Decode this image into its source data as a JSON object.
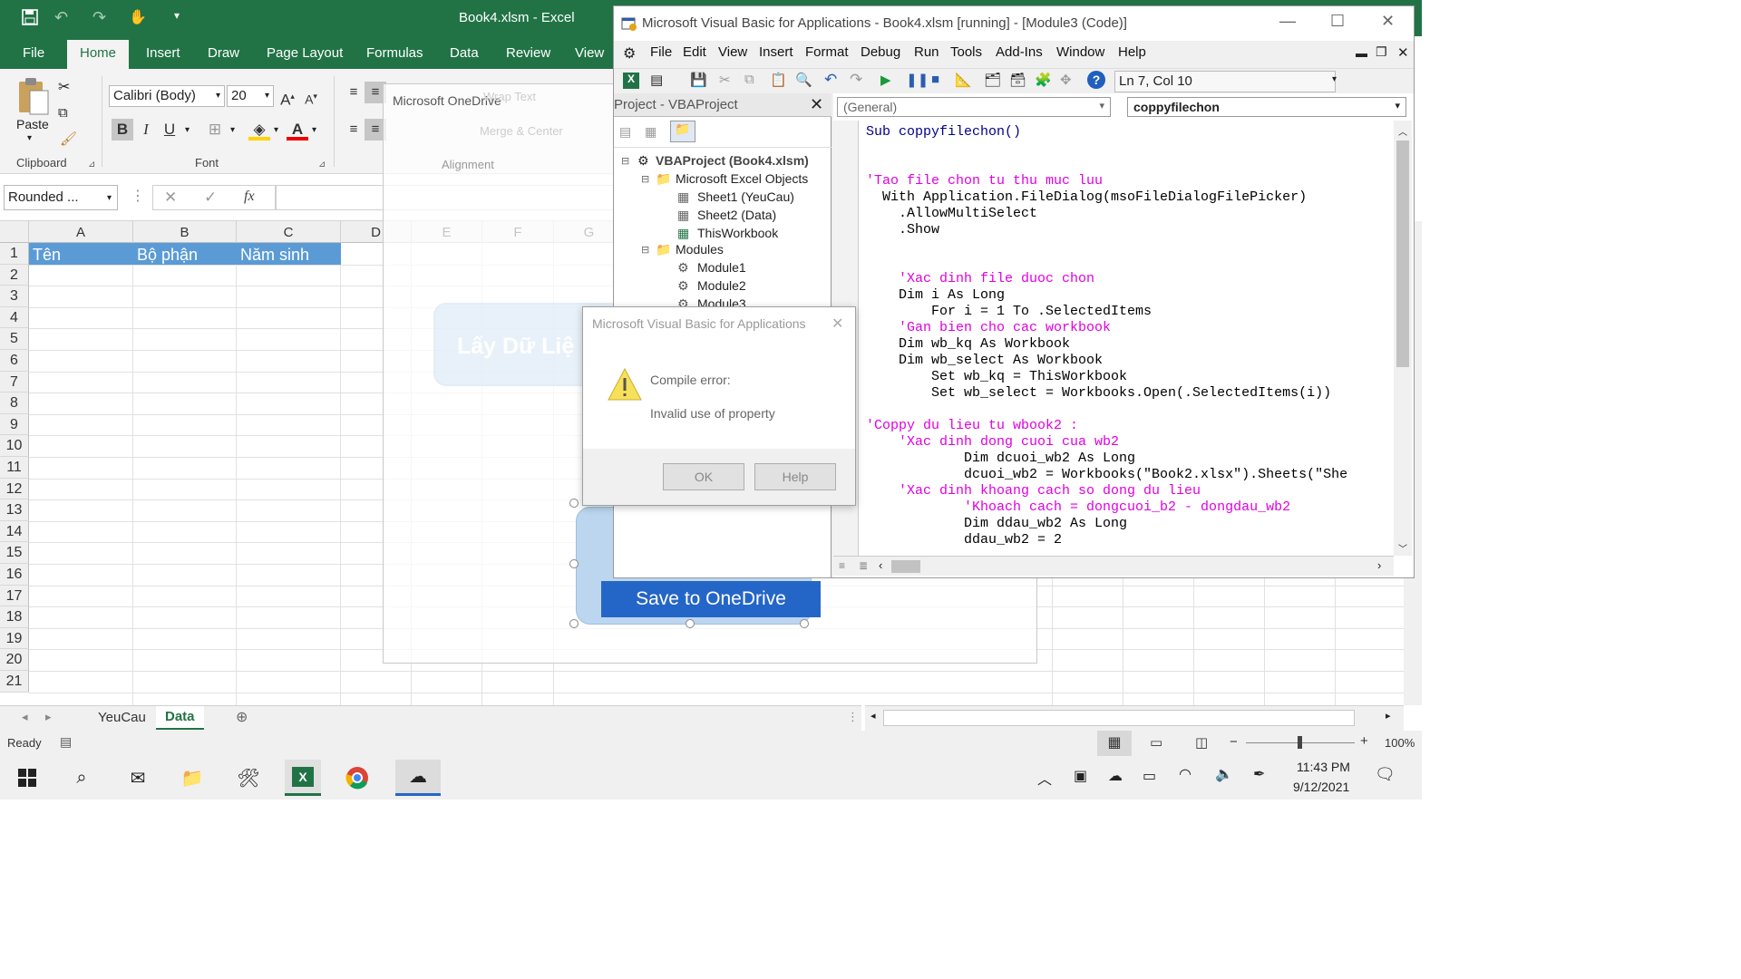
{
  "excel": {
    "title": "Book4.xlsm  -  Excel",
    "tabs": [
      "File",
      "Home",
      "Insert",
      "Draw",
      "Page Layout",
      "Formulas",
      "Data",
      "Review",
      "View"
    ],
    "font_name": "Calibri (Body)",
    "font_size": "20",
    "paste_label": "Paste",
    "groups": {
      "clipboard": "Clipboard",
      "font": "Font",
      "alignment": "Alignment"
    },
    "wrap_text": "Wrap Text",
    "merge_center": "Merge & Center",
    "name_box": "Rounded ...",
    "columns": [
      "A",
      "B",
      "C",
      "D",
      "E",
      "F",
      "G"
    ],
    "rows": [
      "1",
      "2",
      "3",
      "4",
      "5",
      "6",
      "7",
      "8",
      "9",
      "10",
      "11",
      "12",
      "13",
      "14",
      "15",
      "16",
      "17",
      "18",
      "19",
      "20",
      "21"
    ],
    "header_cells": [
      "Tên",
      "Bộ phận",
      "Năm sinh"
    ],
    "button_shape": "Lấy Dữ Liệ",
    "sheets": [
      "YeuCau",
      "Data"
    ],
    "status": "Ready",
    "zoom": "100%",
    "fx_label": "fx"
  },
  "onedrive": {
    "title": "Microsoft OneDrive",
    "button": "Save to OneDrive"
  },
  "vba": {
    "title": "Microsoft Visual Basic for Applications - Book4.xlsm [running] - [Module3 (Code)]",
    "menus": [
      "File",
      "Edit",
      "View",
      "Insert",
      "Format",
      "Debug",
      "Run",
      "Tools",
      "Add-Ins",
      "Window",
      "Help"
    ],
    "position": "Ln 7, Col 10",
    "project_title": "Project - VBAProject",
    "tree": {
      "root": "VBAProject (Book4.xlsm)",
      "objects_folder": "Microsoft Excel Objects",
      "objects": [
        "Sheet1 (YeuCau)",
        "Sheet2 (Data)",
        "ThisWorkbook"
      ],
      "modules_folder": "Modules",
      "modules": [
        "Module1",
        "Module2",
        "Module3"
      ]
    },
    "object_dropdown": "(General)",
    "proc_dropdown": "coppyfilechon",
    "code": [
      {
        "t": "Sub coppyfilechon()",
        "c": "kw"
      },
      {
        "t": "",
        "c": ""
      },
      {
        "t": "",
        "c": ""
      },
      {
        "t": "'Tao file chon tu thu muc luu",
        "c": "cm"
      },
      {
        "t": "  With Application.FileDialog(msoFileDialogFilePicker)",
        "c": ""
      },
      {
        "t": "    .AllowMultiSelect",
        "c": ""
      },
      {
        "t": "    .Show",
        "c": ""
      },
      {
        "t": "",
        "c": ""
      },
      {
        "t": "",
        "c": ""
      },
      {
        "t": "    'Xac dinh file duoc chon",
        "c": "cm"
      },
      {
        "t": "    Dim i As Long",
        "c": ""
      },
      {
        "t": "        For i = 1 To .SelectedItems",
        "c": ""
      },
      {
        "t": "    'Gan bien cho cac workbook",
        "c": "cm"
      },
      {
        "t": "    Dim wb_kq As Workbook",
        "c": ""
      },
      {
        "t": "    Dim wb_select As Workbook",
        "c": ""
      },
      {
        "t": "        Set wb_kq = ThisWorkbook",
        "c": ""
      },
      {
        "t": "        Set wb_select = Workbooks.Open(.SelectedItems(i))",
        "c": ""
      },
      {
        "t": "",
        "c": ""
      },
      {
        "t": "'Coppy du lieu tu wbook2 :",
        "c": "cm"
      },
      {
        "t": "    'Xac dinh dong cuoi cua wb2",
        "c": "cm"
      },
      {
        "t": "            Dim dcuoi_wb2 As Long",
        "c": ""
      },
      {
        "t": "            dcuoi_wb2 = Workbooks(\"Book2.xlsx\").Sheets(\"She",
        "c": ""
      },
      {
        "t": "    'Xac dinh khoang cach so dong du lieu",
        "c": "cm"
      },
      {
        "t": "            'Khoach cach = dongcuoi_b2 - dongdau_wb2",
        "c": "cm"
      },
      {
        "t": "            Dim ddau_wb2 As Long",
        "c": ""
      },
      {
        "t": "            ddau_wb2 = 2",
        "c": ""
      }
    ]
  },
  "dialog": {
    "title": "Microsoft Visual Basic for Applications",
    "heading": "Compile error:",
    "message": "Invalid use of property",
    "ok": "OK",
    "help": "Help"
  },
  "taskbar": {
    "time": "11:43 PM",
    "date": "9/12/2021"
  },
  "colors": {
    "excel_green": "#217346",
    "header_blue": "#5b9bd5",
    "onedrive_blue": "#1f6fd1",
    "comment": "#e000e0"
  }
}
